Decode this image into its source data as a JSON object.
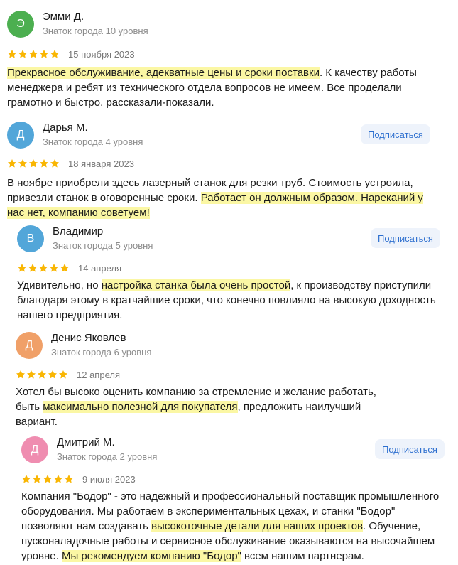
{
  "colors": {
    "star": "#f9b603",
    "highlight": "#fbf7a4",
    "avatar_green": "#4caf50",
    "avatar_blue": "#52a6d9",
    "avatar_orange": "#f0a068",
    "avatar_pink": "#ef8db0",
    "subscribe_text": "#2d6fcf"
  },
  "icons": {
    "star": "star-icon"
  },
  "reviews": [
    {
      "avatar_letter": "Э",
      "name": "Эмми Д.",
      "level": "Знаток города 10 уровня",
      "rating": 5,
      "date": "15 ноября 2023",
      "text": {
        "hl1": "Прекрасное обслуживание, адекватные цены и сроки поставки",
        "t1": ". К качеству работы менеджера и ребят из технического отдела вопросов не имеем. Все проделали грамотно и быстро, рассказали-показали."
      }
    },
    {
      "avatar_letter": "Д",
      "name": "Дарья М.",
      "level": "Знаток города 4 уровня",
      "subscribe": "Подписаться",
      "rating": 5,
      "date": "18 января 2023",
      "text": {
        "t1": "В ноябре приобрели здесь лазерный станок для резки труб. Стоимость устроила, привезли станок в оговоренные сроки. ",
        "hl1": "Работает он должным образом. Нареканий у нас нет, компанию советуем!"
      }
    },
    {
      "avatar_letter": "В",
      "name": "Владимир",
      "level": "Знаток города 5 уровня",
      "subscribe": "Подписаться",
      "rating": 5,
      "date": "14 апреля",
      "text": {
        "t1": "Удивительно, но ",
        "hl1": "настройка станка была очень простой",
        "t2": ", к производству приступили благодаря этому в кратчайшие сроки, что конечно повлияло на высокую доходность нашего предприятия."
      }
    },
    {
      "avatar_letter": "Д",
      "name": "Денис Яковлев",
      "level": "Знаток города 6 уровня",
      "rating": 5,
      "date": "12 апреля",
      "text": {
        "t1": "Хотел бы высоко оценить компанию за стремление и желание работать, быть ",
        "hl1": "максимально полезной для покупателя",
        "t2": ", предложить наилучший вариант."
      }
    },
    {
      "avatar_letter": "Д",
      "name": "Дмитрий М.",
      "level": "Знаток города 2 уровня",
      "subscribe": "Подписаться",
      "rating": 5,
      "date": "9 июля 2023",
      "text": {
        "t1": "Компания \"Бодор\" - это надежный и профессиональный поставщик промышленного оборудования. Мы работаем в экспериментальных цехах, и станки \"Бодор\" позволяют нам создавать ",
        "hl1": "высокоточные детали для наших проектов",
        "t2": ". Обучение, пусконаладочные работы и сервисное обслуживание оказываются на высочайшем уровне. ",
        "hl2": "Мы рекомендуем компанию \"Бодор\"",
        "t3": " всем нашим партнерам."
      }
    }
  ]
}
